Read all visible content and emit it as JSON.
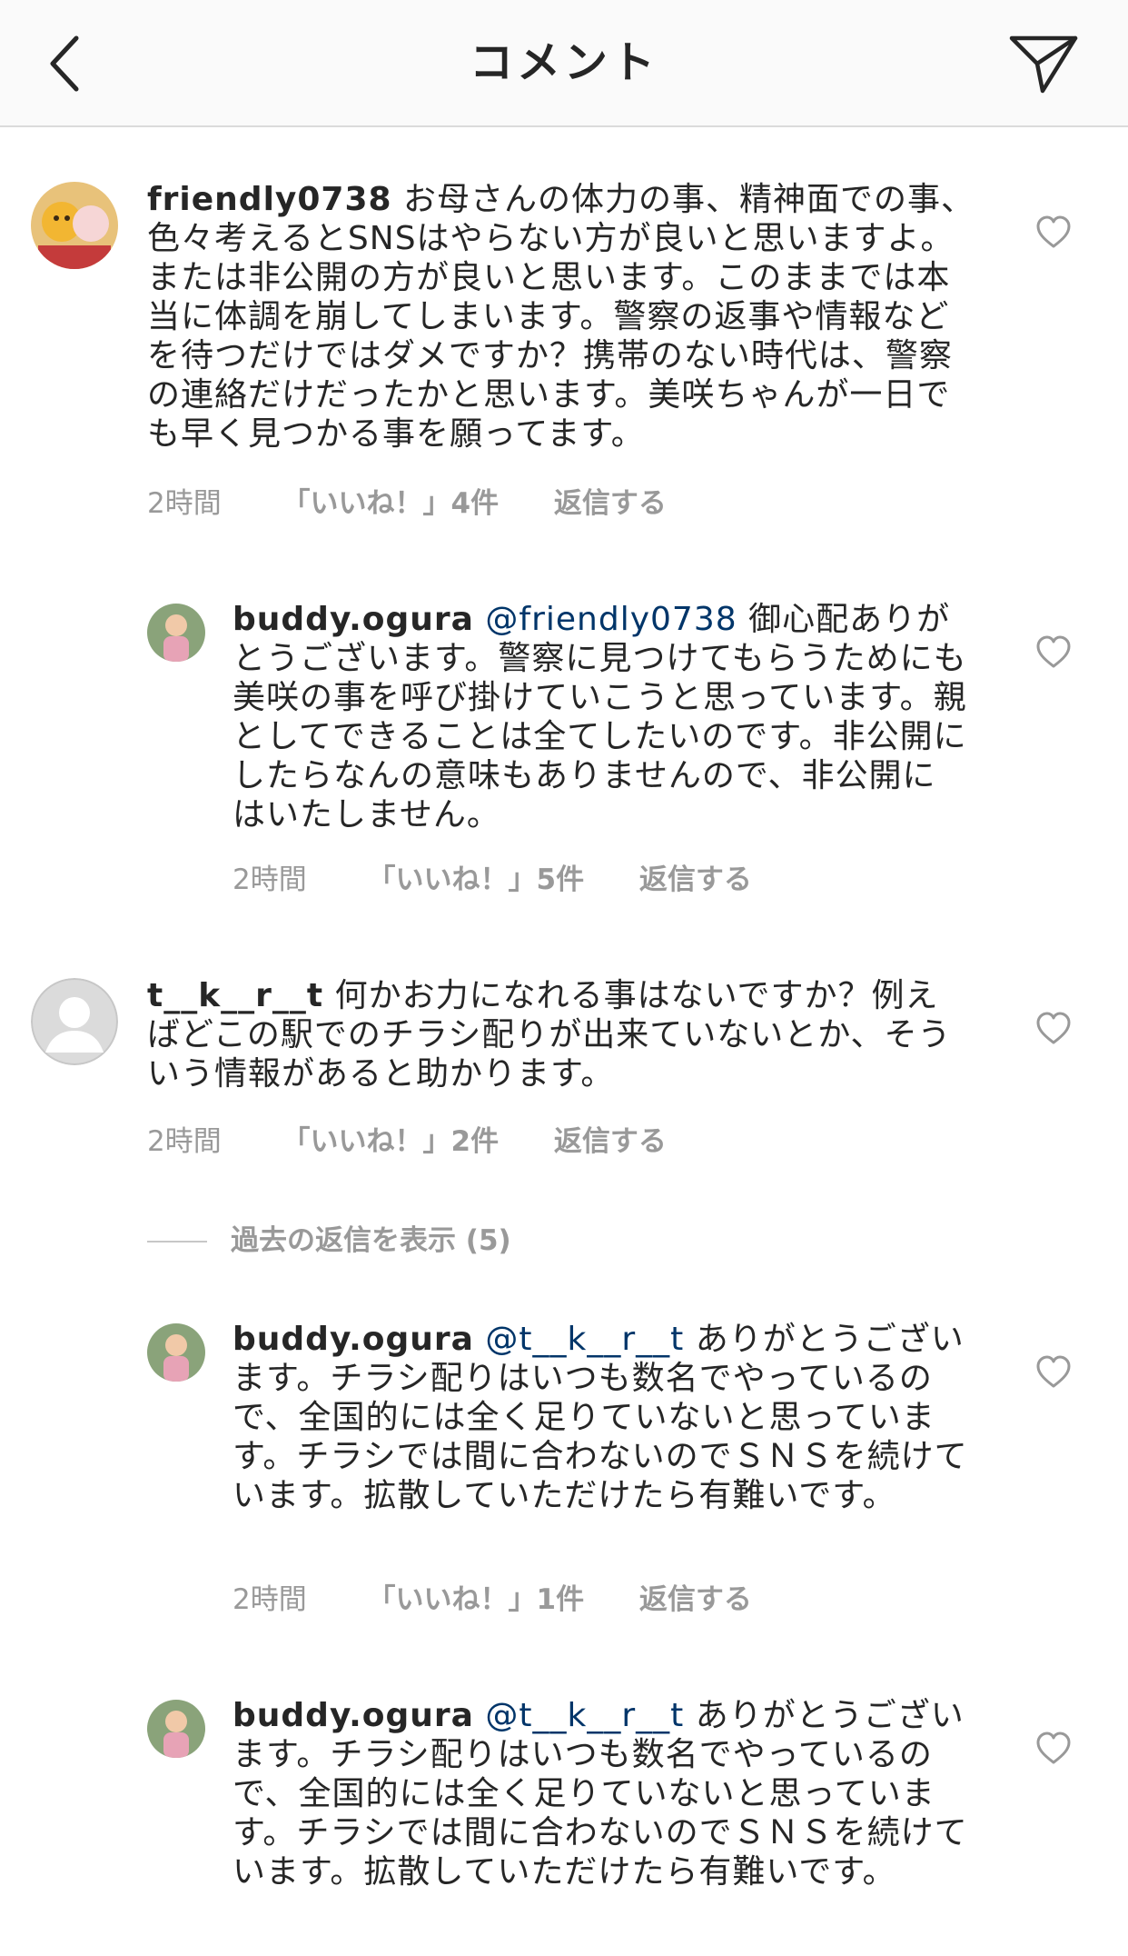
{
  "header": {
    "title": "コメント"
  },
  "comments": [
    {
      "username": "friendly0738",
      "mention": "",
      "text": "お母さんの体力の事、精神面での事、色々考えるとSNSはやらない方が良いと思いますよ。または非公開の方が良いと思います。このままでは本当に体調を崩してしまいます。警察の返事や情報などを待つだけではダメですか？携帯のない時代は、警察の連絡だけだったかと思います。美咲ちゃんが一日でも早く見つかる事を願ってます。",
      "time": "2時間",
      "likes": "「いいね！」4件",
      "reply": "返信する"
    },
    {
      "username": "buddy.ogura",
      "mention": "@friendly0738",
      "text": "御心配ありがとうございます。警察に見つけてもらうためにも美咲の事を呼び掛けていこうと思っています。親としてできることは全てしたいのです。非公開にしたらなんの意味もありませんので、非公開にはいたしません。",
      "time": "2時間",
      "likes": "「いいね！」5件",
      "reply": "返信する"
    },
    {
      "username": "t__k__r__t",
      "mention": "",
      "text": "何かお力になれる事はないですか？例えばどこの駅でのチラシ配りが出来ていないとか、そういう情報があると助かります。",
      "time": "2時間",
      "likes": "「いいね！」2件",
      "reply": "返信する"
    },
    {
      "username": "buddy.ogura",
      "mention": "@t__k__r__t",
      "text": "ありがとうございます。チラシ配りはいつも数名でやっているので、全国的には全く足りていないと思っています。チラシでは間に合わないのでＳＮＳを続けています。拡散していただけたら有難いです。",
      "time": "2時間",
      "likes": "「いいね！」1件",
      "reply": "返信する"
    },
    {
      "username": "buddy.ogura",
      "mention": "@t__k__r__t",
      "text": "ありがとうございます。チラシ配りはいつも数名でやっているので、全国的には全く足りていないと思っています。チラシでは間に合わないのでＳＮＳを続けています。拡散していただけたら有難いです。",
      "time": "",
      "likes": "",
      "reply": ""
    }
  ],
  "view_previous": "過去の返信を表示 (5)",
  "icons": {
    "back": "chevron-left-icon",
    "send": "paper-plane-icon",
    "like": "heart-outline-icon"
  },
  "colors": {
    "mention": "#003569",
    "meta": "#999999",
    "header_bg": "#fafafa"
  }
}
